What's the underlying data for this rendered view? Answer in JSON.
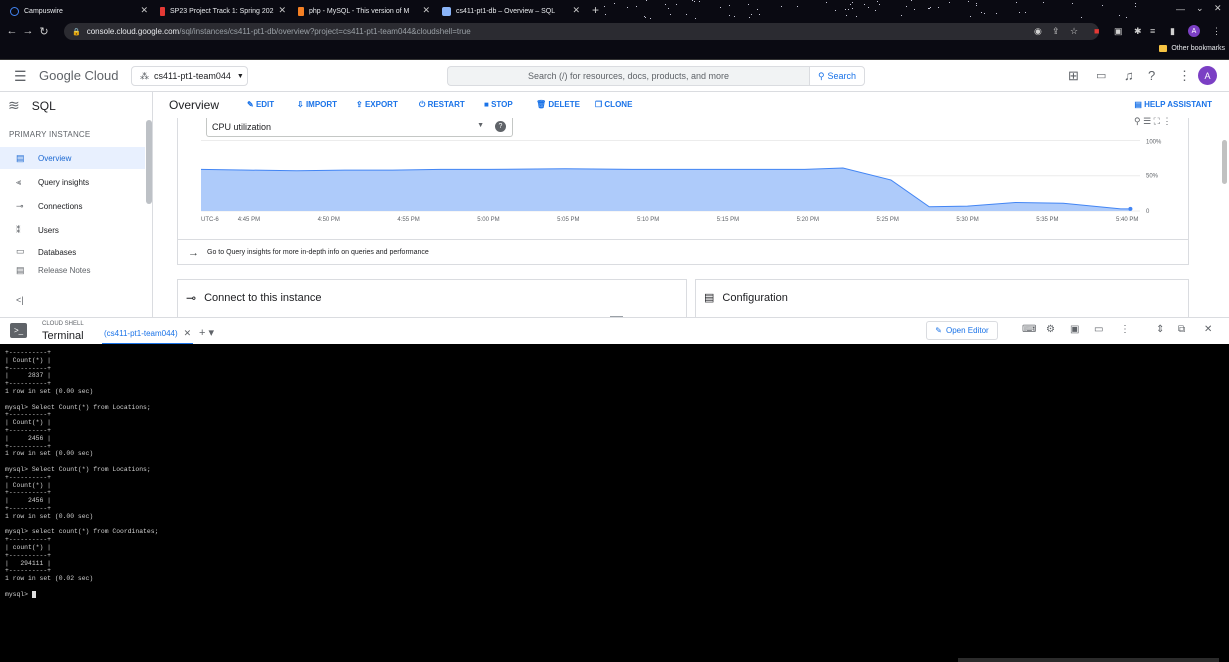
{
  "browser": {
    "tabs": [
      {
        "title": "Campuswire",
        "icon_color": "#4285f4"
      },
      {
        "title": "SP23 Project Track 1: Spring 202",
        "icon_color": "#e53935"
      },
      {
        "title": "php - MySQL - This version of M",
        "icon_color": "#f48024"
      },
      {
        "title": "cs411-pt1-db – Overview – SQL",
        "icon_color": "#8ab4f8"
      }
    ],
    "url_host": "console.cloud.google.com",
    "url_path": "/sql/instances/cs411-pt1-db/overview?project=cs411-pt1-team044&cloudshell=true",
    "other_bookmarks": "Other bookmarks",
    "avatar_letter": "A"
  },
  "header": {
    "brand": "Google Cloud",
    "project": "cs411-pt1-team044",
    "search_placeholder": "Search (/) for resources, docs, products, and more",
    "search_button": "Search",
    "avatar_letter": "A"
  },
  "sidebar": {
    "product": "SQL",
    "section": "PRIMARY INSTANCE",
    "items": [
      {
        "label": "Overview",
        "icon": "grid-icon",
        "active": true
      },
      {
        "label": "Query insights",
        "icon": "chart-icon"
      },
      {
        "label": "Connections",
        "icon": "connection-icon"
      },
      {
        "label": "Users",
        "icon": "users-icon"
      },
      {
        "label": "Databases",
        "icon": "database-icon"
      },
      {
        "label": "Release Notes",
        "icon": "notes-icon"
      }
    ]
  },
  "toolbar": {
    "title": "Overview",
    "actions": [
      "EDIT",
      "IMPORT",
      "EXPORT",
      "RESTART",
      "STOP",
      "DELETE",
      "CLONE"
    ],
    "help": "HELP ASSISTANT"
  },
  "metric": {
    "selected": "CPU utilization"
  },
  "chart_data": {
    "type": "area",
    "title": "",
    "x": [
      "UTC-6",
      "4:45 PM",
      "4:50 PM",
      "4:55 PM",
      "5:00 PM",
      "5:05 PM",
      "5:10 PM",
      "5:15 PM",
      "5:20 PM",
      "5:25 PM",
      "5:30 PM",
      "5:35 PM",
      "5:40 PM"
    ],
    "y_ticks": [
      "100%",
      "50%",
      "0"
    ],
    "ylim": [
      0,
      100
    ],
    "series": [
      {
        "points": [
          [
            4.7,
            59
          ],
          [
            4.75,
            58
          ],
          [
            4.8,
            57
          ],
          [
            4.85,
            58
          ],
          [
            4.9,
            58
          ],
          [
            4.95,
            59
          ],
          [
            5.0,
            59
          ],
          [
            5.08,
            60
          ],
          [
            5.15,
            59
          ],
          [
            5.2,
            59
          ],
          [
            5.28,
            59
          ],
          [
            5.33,
            59
          ],
          [
            5.37,
            61
          ],
          [
            5.42,
            44
          ],
          [
            5.46,
            6
          ],
          [
            5.5,
            7
          ],
          [
            5.55,
            12
          ],
          [
            5.6,
            11
          ],
          [
            5.66,
            3
          ],
          [
            5.67,
            3
          ]
        ]
      }
    ],
    "fill_color": "#aecbfa",
    "line_color": "#4285f4"
  },
  "insight_link": "Go to Query insights for more in-depth info on queries and performance",
  "sections": {
    "connect": "Connect to this instance",
    "configuration": "Configuration"
  },
  "shell": {
    "small_label": "CLOUD SHELL",
    "title": "Terminal",
    "tab": "(cs411-pt1-team044)",
    "open_editor": "Open Editor"
  },
  "terminal_lines": [
    "+----------+",
    "| Count(*) |",
    "+----------+",
    "|     2837 |",
    "+----------+",
    "1 row in set (0.00 sec)",
    "",
    "mysql> Select Count(*) from Locations;",
    "+----------+",
    "| Count(*) |",
    "+----------+",
    "|     2456 |",
    "+----------+",
    "1 row in set (0.00 sec)",
    "",
    "mysql> Select Count(*) from Locations;",
    "+----------+",
    "| Count(*) |",
    "+----------+",
    "|     2456 |",
    "+----------+",
    "1 row in set (0.00 sec)",
    "",
    "mysql> select count(*) from Coordinates;",
    "+----------+",
    "| count(*) |",
    "+----------+",
    "|   294111 |",
    "+----------+",
    "1 row in set (0.02 sec)",
    ""
  ],
  "prompt": "mysql> "
}
